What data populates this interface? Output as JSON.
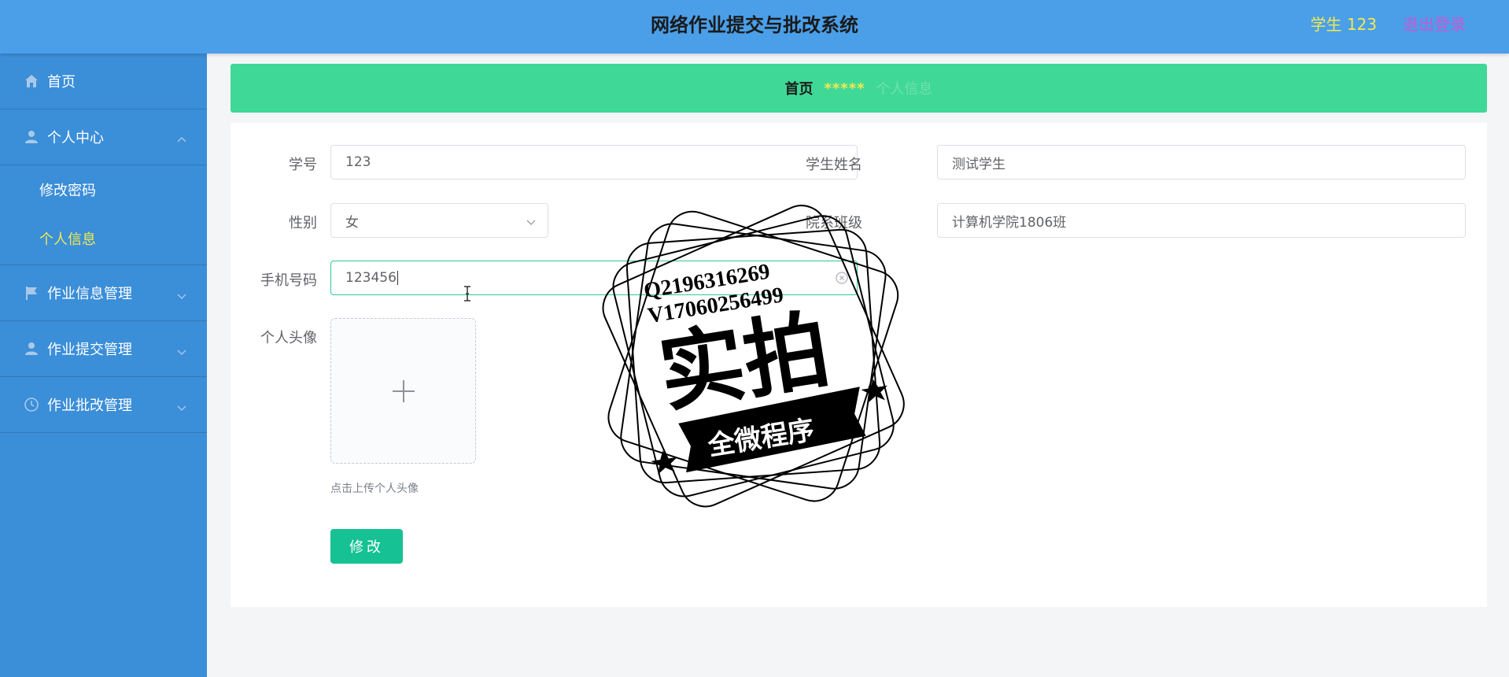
{
  "header": {
    "title": "网络作业提交与批改系统",
    "user": "学生 123",
    "logout": "退出登录"
  },
  "sidebar": {
    "items": [
      {
        "label": "首页",
        "icon": "home-icon"
      },
      {
        "label": "个人中心",
        "icon": "user-icon",
        "expanded": true,
        "children": [
          {
            "label": "修改密码"
          },
          {
            "label": "个人信息",
            "active": true
          }
        ]
      },
      {
        "label": "作业信息管理",
        "icon": "flag-icon"
      },
      {
        "label": "作业提交管理",
        "icon": "user-icon"
      },
      {
        "label": "作业批改管理",
        "icon": "clock-icon"
      }
    ]
  },
  "breadcrumb": {
    "home": "首页",
    "separator": "*****",
    "current": "个人信息"
  },
  "form": {
    "student_id_label": "学号",
    "student_id_value": "123",
    "name_label": "学生姓名",
    "name_value": "测试学生",
    "gender_label": "性别",
    "gender_value": "女",
    "class_label": "院系班级",
    "class_value": "计算机学院1806班",
    "phone_label": "手机号码",
    "phone_value": "123456",
    "avatar_label": "个人头像",
    "avatar_tip": "点击上传个人头像",
    "submit_label": "修改"
  },
  "watermark": {
    "line1": "Q2196316269",
    "line2": "V17060256499",
    "main": "实拍",
    "ribbon": "全微程序"
  },
  "colors": {
    "header_bg": "#4a9fe8",
    "sidebar_bg": "#3b8ed8",
    "breadcrumb_bg": "#40d896",
    "accent_yellow": "#f2e94e",
    "logout": "#c957d6",
    "button": "#16c194"
  }
}
